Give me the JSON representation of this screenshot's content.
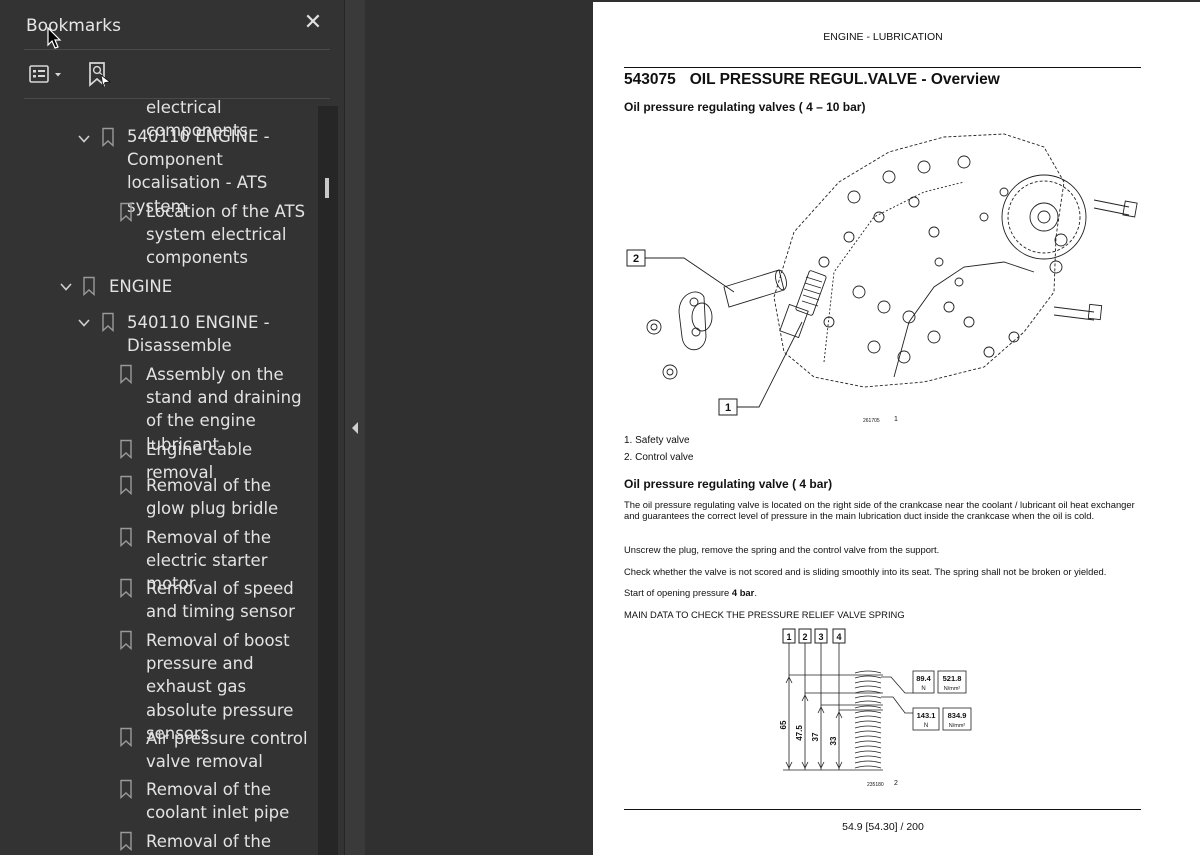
{
  "sidebar": {
    "title": "Bookmarks",
    "close_symbol": "✕",
    "icons": {
      "close": "close-icon",
      "options": "list-options-icon",
      "find": "bookmark-find-icon",
      "collapse": "collapse-left-icon"
    },
    "items": [
      {
        "label": "electrical components",
        "expander": "none"
      },
      {
        "label": "540110     ENGINE - Component localisation - ATS system",
        "expander": "expanded"
      },
      {
        "label": "Location of the ATS system electrical components",
        "expander": "none"
      },
      {
        "label": "ENGINE",
        "expander": "expanded"
      },
      {
        "label": "540110     ENGINE - Disassemble",
        "expander": "expanded"
      },
      {
        "label": "Assembly on the stand and draining of the engine lubricant",
        "expander": "none"
      },
      {
        "label": "Engine cable removal",
        "expander": "none"
      },
      {
        "label": "Removal of the glow plug bridle",
        "expander": "none"
      },
      {
        "label": "Removal of the electric starter motor",
        "expander": "none"
      },
      {
        "label": "Removal of speed and timing sensor",
        "expander": "none"
      },
      {
        "label": "Removal of boost pressure and exhaust gas absolute pressure sensors",
        "expander": "none"
      },
      {
        "label": "Air pressure control valve removal",
        "expander": "none"
      },
      {
        "label": "Removal of the coolant inlet pipe",
        "expander": "none"
      },
      {
        "label": "Removal of the",
        "expander": "none"
      }
    ]
  },
  "document": {
    "running_head": "ENGINE - LUBRICATION",
    "section_number": "543075",
    "section_title": "OIL PRESSURE REGUL.VALVE - Overview",
    "subheading1": "Oil pressure regulating valves ( 4 – 10 bar)",
    "figure1": {
      "callouts": [
        "2",
        "1"
      ],
      "code": "261705",
      "number": "1"
    },
    "captions": [
      "1.  Safety valve",
      "2.  Control valve"
    ],
    "subheading2": "Oil pressure regulating valve ( 4 bar)",
    "paragraphs": [
      "The oil pressure regulating valve is located on the right side of the crankcase near the coolant / lubricant oil heat exchanger and guarantees the correct level of pressure in the main lubrication duct inside the crankcase when the oil is cold.",
      "Unscrew the plug, remove the spring and the control valve from the support.",
      "Check whether the valve is not scored and is sliding smoothly into its seat. The spring shall not be broken or yielded."
    ],
    "opening_pressure_prefix": "Start of opening pressure ",
    "opening_pressure_value": "4 bar",
    "opening_pressure_suffix": ".",
    "main_data_heading": "MAIN DATA TO CHECK THE PRESSURE RELIEF VALVE SPRING",
    "figure2": {
      "column_labels": [
        "1",
        "2",
        "3",
        "4"
      ],
      "dimensions": [
        "65",
        "47.5",
        "37",
        "33"
      ],
      "loads": [
        {
          "force": "89.4",
          "force_unit": "N",
          "stiffness": "521.8",
          "stiffness_unit": "N/mm²"
        },
        {
          "force": "143.1",
          "force_unit": "N",
          "stiffness": "834.9",
          "stiffness_unit": "N/mm²"
        }
      ],
      "code": "235180",
      "number": "2"
    },
    "footer": "54.9 [54.30] / 200"
  },
  "colors": {
    "sidebar_bg": "#333333",
    "sidebar_text": "#e3e3e3",
    "doc_bg": "#303030",
    "page_bg": "#ffffff"
  }
}
